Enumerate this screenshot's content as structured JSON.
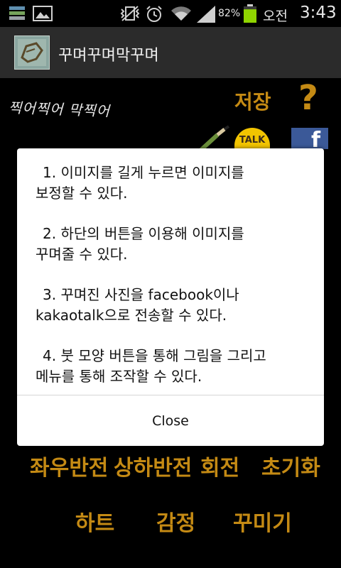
{
  "status_bar": {
    "battery_percent": "82%",
    "am_pm": "오전",
    "time": "3:43",
    "battery_level": 0.82
  },
  "app_bar": {
    "title": "꾸며꾸며막꾸며"
  },
  "main": {
    "handwritten_label": "찍어찍어 막찍어",
    "save_label": "저장",
    "help_label": "?",
    "kakaotalk_label": "TALK",
    "facebook_label": "f",
    "buttons": {
      "flip_horizontal": "좌우반전",
      "flip_vertical": "상하반전",
      "rotate": "회전",
      "reset": "초기화",
      "heart": "하트",
      "emotion": "감정",
      "decorate": "꾸미기"
    }
  },
  "dialog": {
    "para1": {
      "line1": "1. 이미지를 길게 누르면 이미지를",
      "line2": "보정할 수 있다."
    },
    "para2": {
      "line1": "2. 하단의 버튼을 이용해 이미지를",
      "line2": "꾸며줄 수 있다."
    },
    "para3": {
      "line1": "3. 꾸며진 사진을 facebook이나",
      "line2": "kakaotalk으로 전송할 수 있다."
    },
    "para4": {
      "line1": "4. 붓 모양 버튼을 통해 그림을 그리고",
      "line2": "메뉴를 통해 조작할 수 있다."
    },
    "close_label": "Close"
  },
  "colors": {
    "accent_gold": "#c48a14",
    "kakao_yellow": "#f2c400",
    "facebook_blue": "#3b5998",
    "battery_green": "#8fd400"
  },
  "icons": [
    "layers-icon",
    "gallery-icon",
    "vibrate-mute-icon",
    "alarm-icon",
    "wifi-icon",
    "signal-icon",
    "battery-icon",
    "brush-icon"
  ]
}
